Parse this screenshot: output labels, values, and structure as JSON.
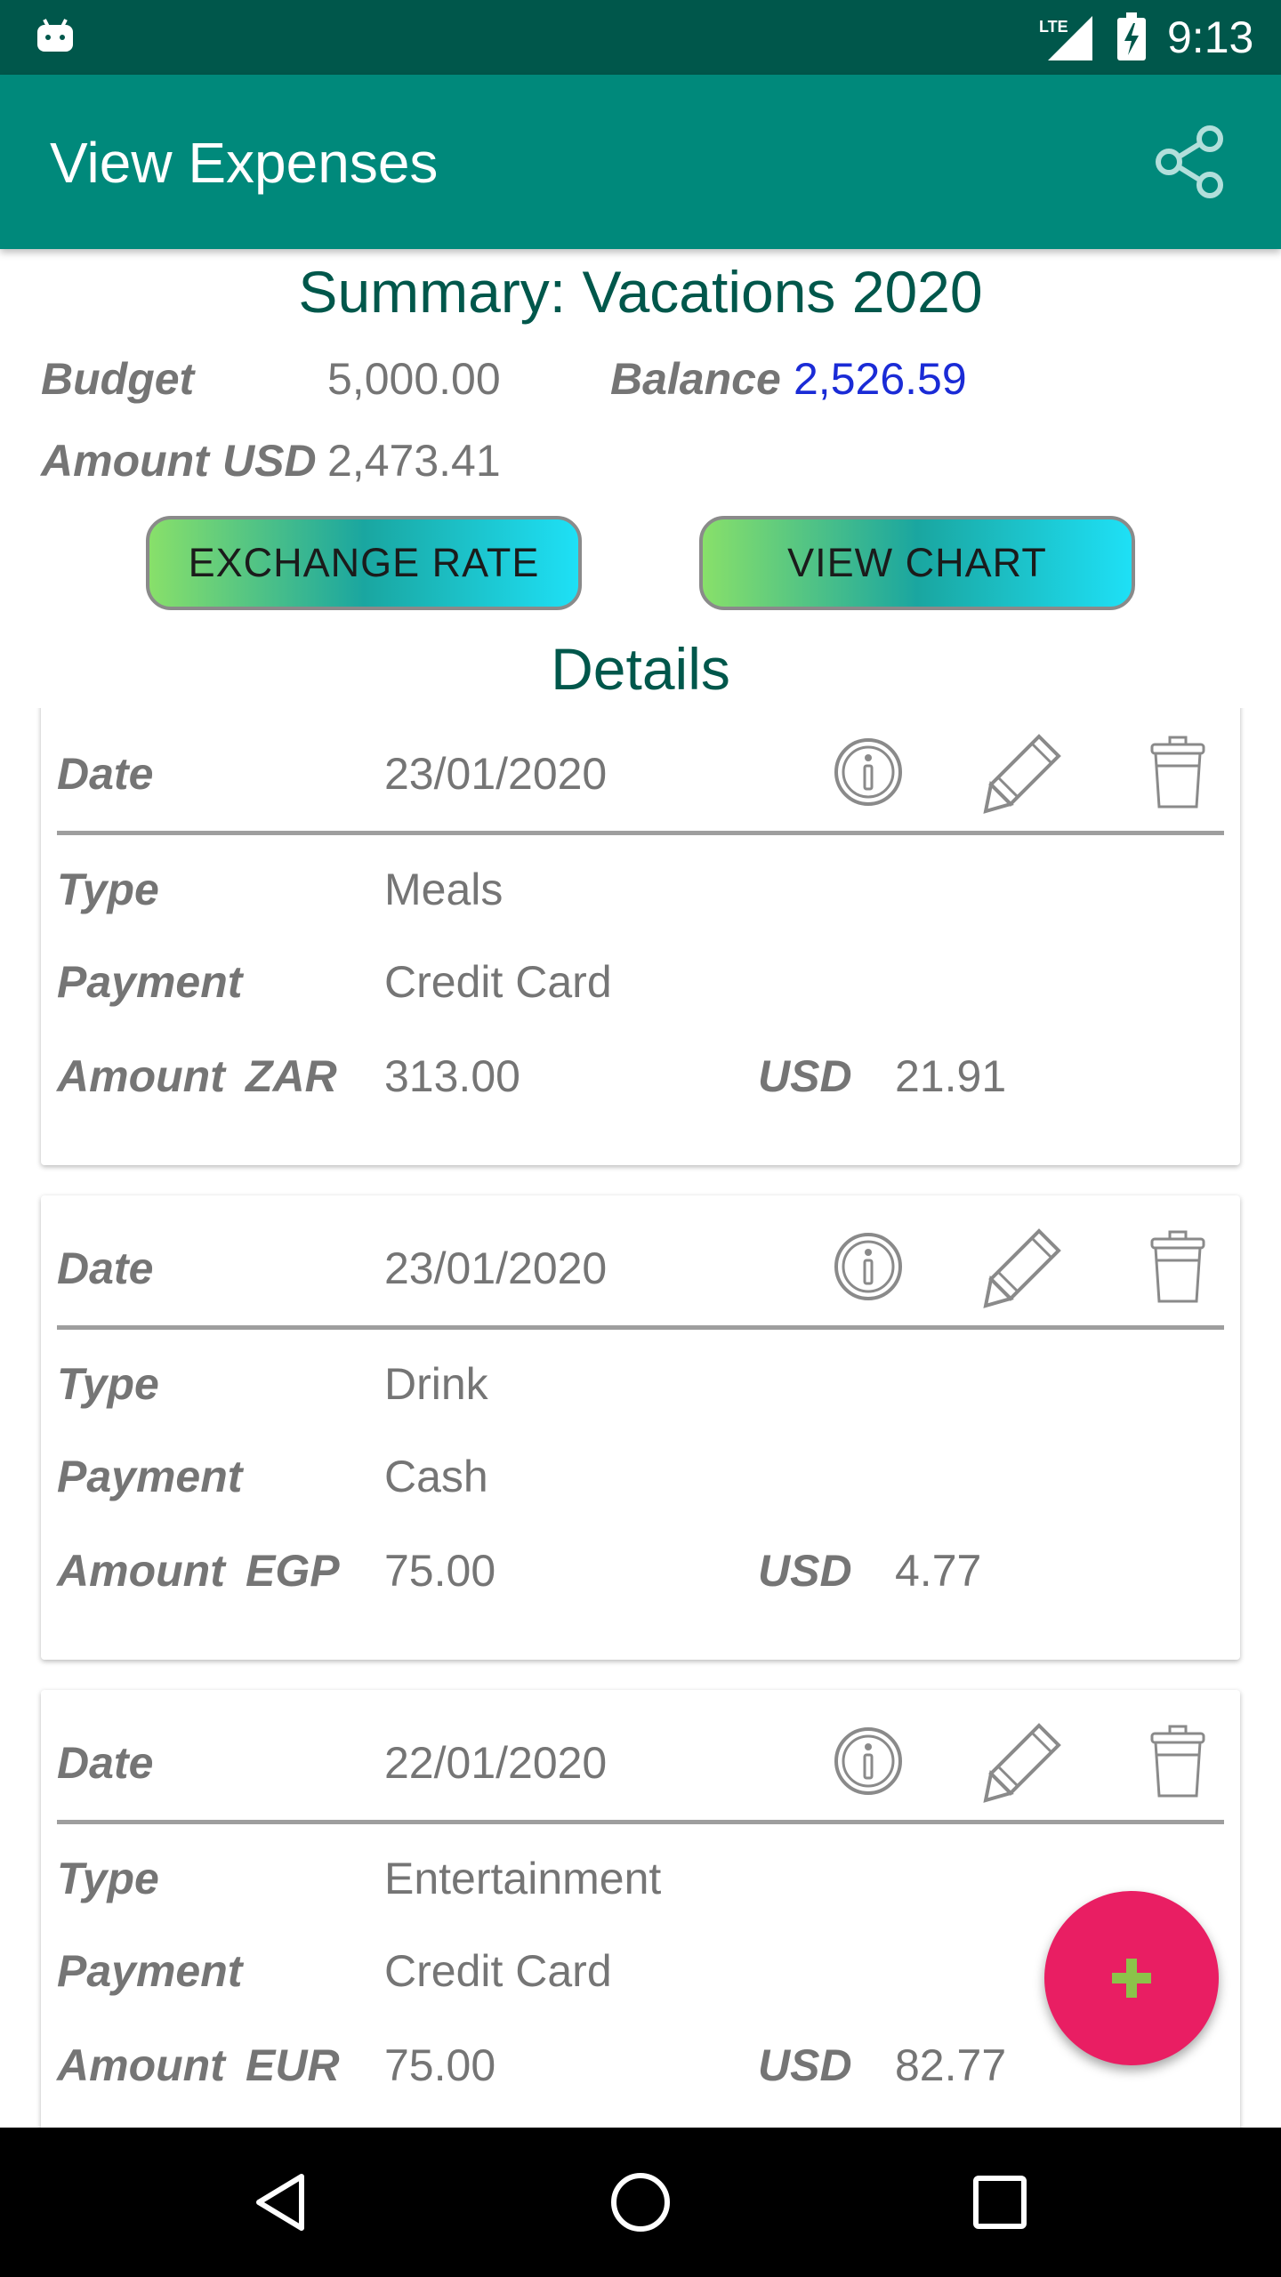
{
  "status_bar": {
    "time": "9:13",
    "network": "LTE"
  },
  "app_bar": {
    "title": "View Expenses",
    "share_icon": "share-icon"
  },
  "summary": {
    "title": "Summary: Vacations 2020",
    "budget_label": "Budget",
    "budget_value": "5,000.00",
    "balance_label": "Balance",
    "balance_value": "2,526.59",
    "amount_label": "Amount",
    "amount_currency": "USD",
    "amount_value": "2,473.41"
  },
  "buttons": {
    "exchange_rate": "EXCHANGE RATE",
    "view_chart": "VIEW CHART"
  },
  "details_title": "Details",
  "labels": {
    "date": "Date",
    "type": "Type",
    "payment": "Payment",
    "amount": "Amount",
    "usd": "USD"
  },
  "expenses": [
    {
      "date": "23/01/2020",
      "type": "Meals",
      "payment": "Credit Card",
      "currency": "ZAR",
      "amount": "313.00",
      "usd": "21.91"
    },
    {
      "date": "23/01/2020",
      "type": "Drink",
      "payment": "Cash",
      "currency": "EGP",
      "amount": "75.00",
      "usd": "4.77"
    },
    {
      "date": "22/01/2020",
      "type": "Entertainment",
      "payment": "Credit Card",
      "currency": "EUR",
      "amount": "75.00",
      "usd": "82.77"
    }
  ],
  "colors": {
    "status_bar": "#00574b",
    "app_bar": "#00897b",
    "accent": "#e91e63",
    "balance": "#1a2bd6"
  }
}
